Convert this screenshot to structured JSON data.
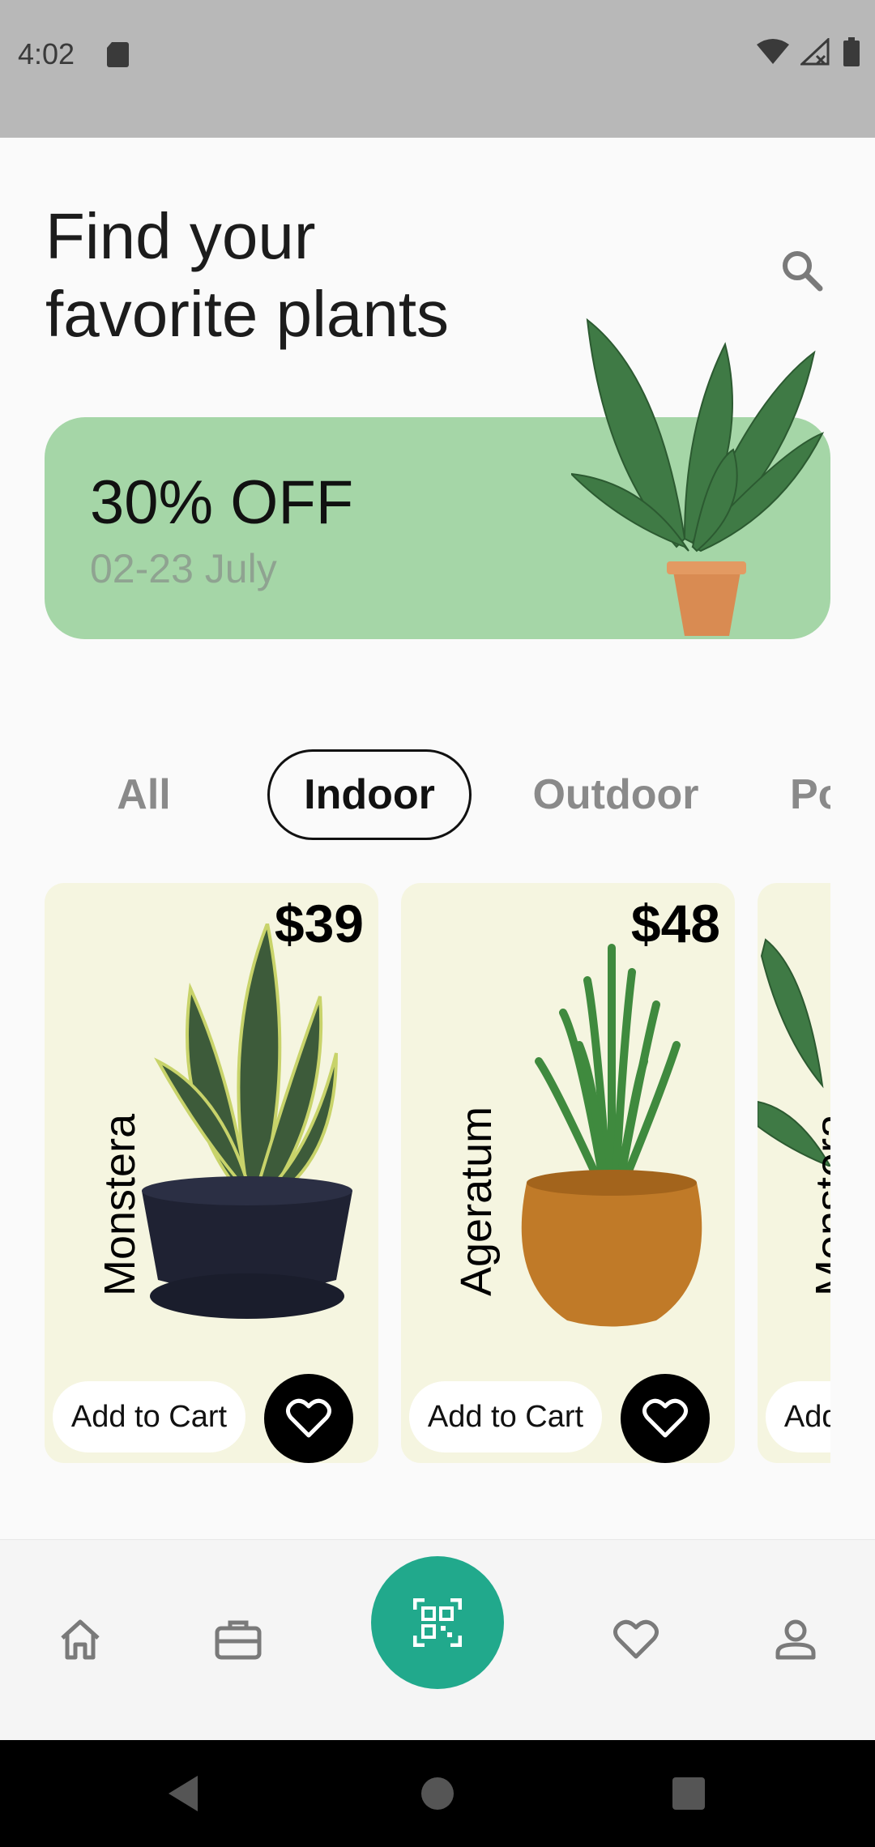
{
  "status_bar": {
    "time": "4:02"
  },
  "header": {
    "title_line1": "Find your",
    "title_line2": "favorite plants"
  },
  "promo": {
    "title": "30% OFF",
    "date": "02-23 July"
  },
  "tabs": [
    "All",
    "Indoor",
    "Outdoor",
    "Popular"
  ],
  "active_tab": "Indoor",
  "products": [
    {
      "name": "Monstera",
      "price": "$39",
      "cart_label": "Add to Cart"
    },
    {
      "name": "Ageratum",
      "price": "$48",
      "cart_label": "Add to Cart"
    },
    {
      "name": "Monstera",
      "price": "",
      "cart_label": "Add to Cart"
    }
  ],
  "colors": {
    "promo_bg": "#a5d6a7",
    "card_bg": "#f5f5e0",
    "accent": "#21a98c",
    "status_bar": "#b8b8b8"
  },
  "nav_icons": [
    "home-icon",
    "briefcase-icon",
    "qr-scan-icon",
    "heart-icon",
    "person-icon"
  ]
}
